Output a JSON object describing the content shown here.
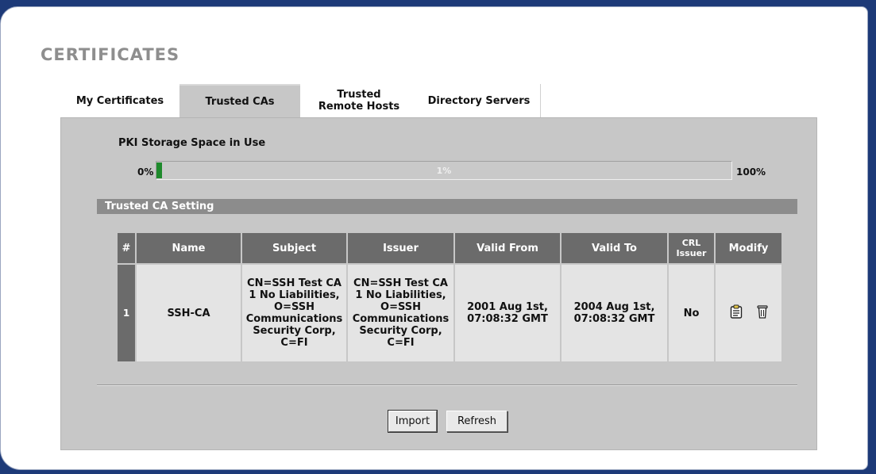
{
  "page": {
    "title": "CERTIFICATES"
  },
  "tabs": [
    {
      "label": "My Certificates",
      "active": false
    },
    {
      "label": "Trusted CAs",
      "active": true
    },
    {
      "label": "Trusted Remote Hosts",
      "active": false
    },
    {
      "label": "Directory Servers",
      "active": false
    }
  ],
  "storage": {
    "title": "PKI Storage Space in Use",
    "min_label": "0%",
    "max_label": "100%",
    "value_label": "1%",
    "fraction": 0.01,
    "fill_color": "#1e8a2c"
  },
  "section": {
    "title": "Trusted CA Setting"
  },
  "table": {
    "headers": {
      "num": "#",
      "name": "Name",
      "subject": "Subject",
      "issuer": "Issuer",
      "valid_from": "Valid From",
      "valid_to": "Valid To",
      "crl_issuer": "CRL Issuer",
      "modify": "Modify"
    },
    "rows": [
      {
        "num": "1",
        "name": "SSH-CA",
        "subject": "CN=SSH Test CA 1 No Liabilities, O=SSH Communications Security Corp, C=FI",
        "issuer": "CN=SSH Test CA 1 No Liabilities, O=SSH Communications Security Corp, C=FI",
        "valid_from": "2001 Aug 1st, 07:08:32 GMT",
        "valid_to": "2004 Aug 1st, 07:08:32 GMT",
        "crl_issuer": "No",
        "actions": [
          "edit-icon",
          "trash-icon"
        ]
      }
    ]
  },
  "buttons": {
    "import": "Import",
    "refresh": "Refresh"
  },
  "colors": {
    "panel": "#c7c7c7",
    "header": "#6b6b6b",
    "section": "#8c8c8c",
    "frame_border": "#1d3a78"
  }
}
